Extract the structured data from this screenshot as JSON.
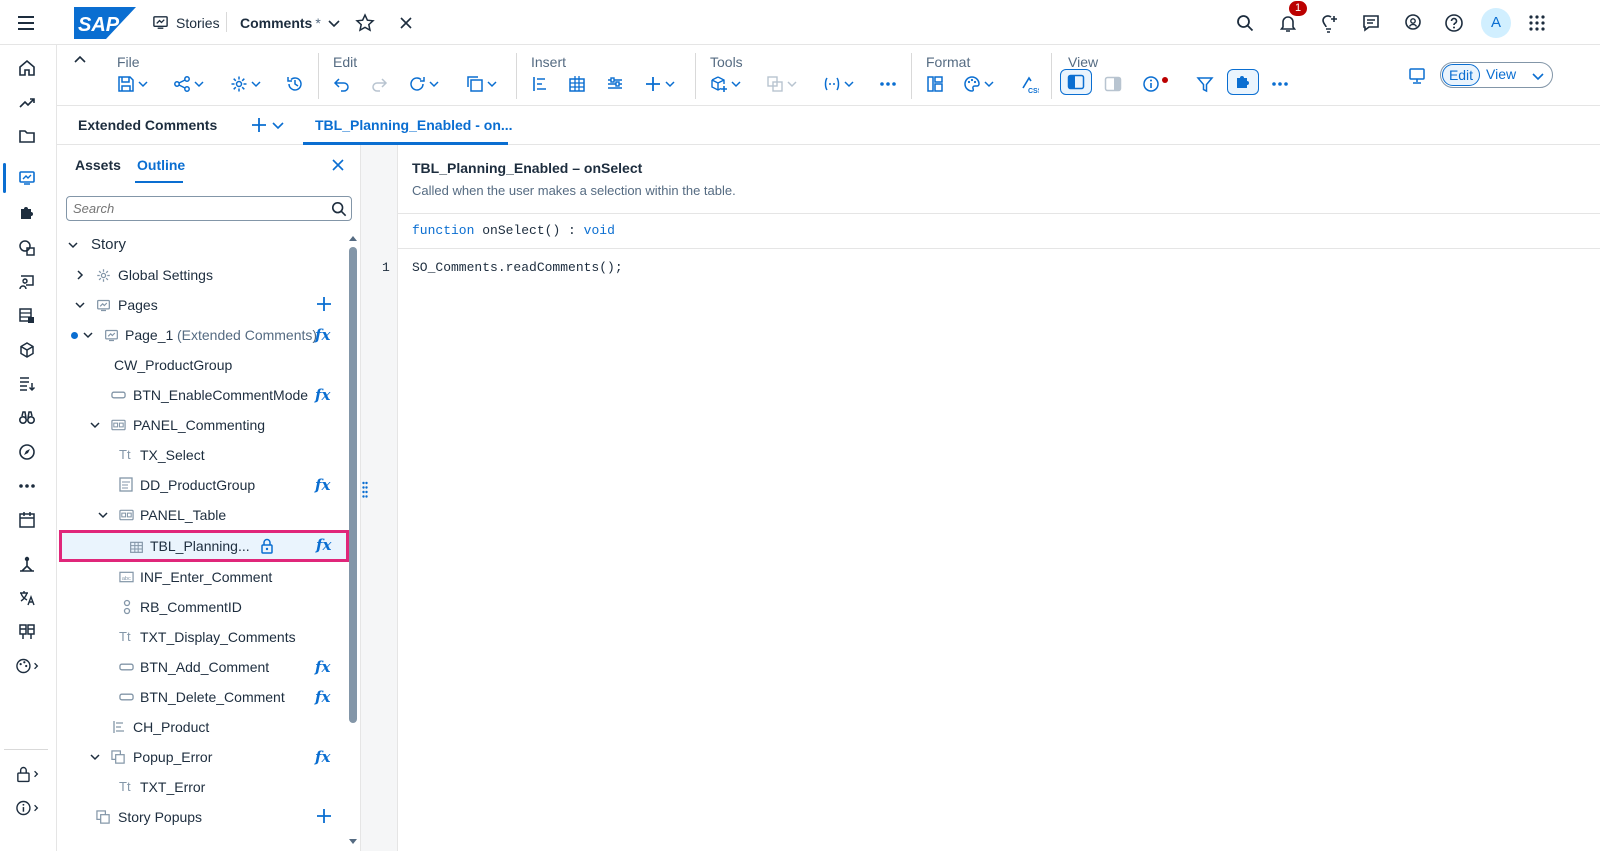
{
  "topbar": {
    "stories_label": "Stories",
    "doc_title": "Comments",
    "doc_modified_mark": "*",
    "notification_count": "1",
    "avatar_initial": "A"
  },
  "toolbar": {
    "groups": {
      "file": "File",
      "edit": "Edit",
      "insert": "Insert",
      "tools": "Tools",
      "format": "Format",
      "view": "View"
    },
    "edit_mode": "Edit",
    "view_mode": "View"
  },
  "tabs": {
    "extended_comments": "Extended Comments",
    "active_script_tab": "TBL_Planning_Enabled - on..."
  },
  "panel": {
    "tab_assets": "Assets",
    "tab_outline": "Outline",
    "search_placeholder": "Search",
    "tree": [
      {
        "label": "Story"
      },
      {
        "label": "Global Settings"
      },
      {
        "label": "Pages"
      },
      {
        "label": "Page_1",
        "suffix": "(Extended Comments)"
      },
      {
        "label": "CW_ProductGroup"
      },
      {
        "label": "BTN_EnableCommentMode"
      },
      {
        "label": "PANEL_Commenting"
      },
      {
        "label": "TX_Select"
      },
      {
        "label": "DD_ProductGroup"
      },
      {
        "label": "PANEL_Table"
      },
      {
        "label": "TBL_Planning..."
      },
      {
        "label": "INF_Enter_Comment"
      },
      {
        "label": "RB_CommentID"
      },
      {
        "label": "TXT_Display_Comments"
      },
      {
        "label": "BTN_Add_Comment"
      },
      {
        "label": "BTN_Delete_Comment"
      },
      {
        "label": "CH_Product"
      },
      {
        "label": "Popup_Error"
      },
      {
        "label": "TXT_Error"
      },
      {
        "label": "Story Popups"
      }
    ],
    "tt_glyph": "Tt",
    "fx_glyph": "fx"
  },
  "editor": {
    "title": "TBL_Planning_Enabled – onSelect",
    "description": "Called when the user makes a selection within the table.",
    "signature_keyword": "function",
    "signature_name": "onSelect() :",
    "signature_return": "void",
    "line_number": "1",
    "code_line": "SO_Comments.readComments();"
  },
  "colors": {
    "accent": "#0a6ed1",
    "highlight_border": "#e0267a",
    "notification_badge": "#bb0000",
    "sap_logo": "#0a6ed1"
  }
}
